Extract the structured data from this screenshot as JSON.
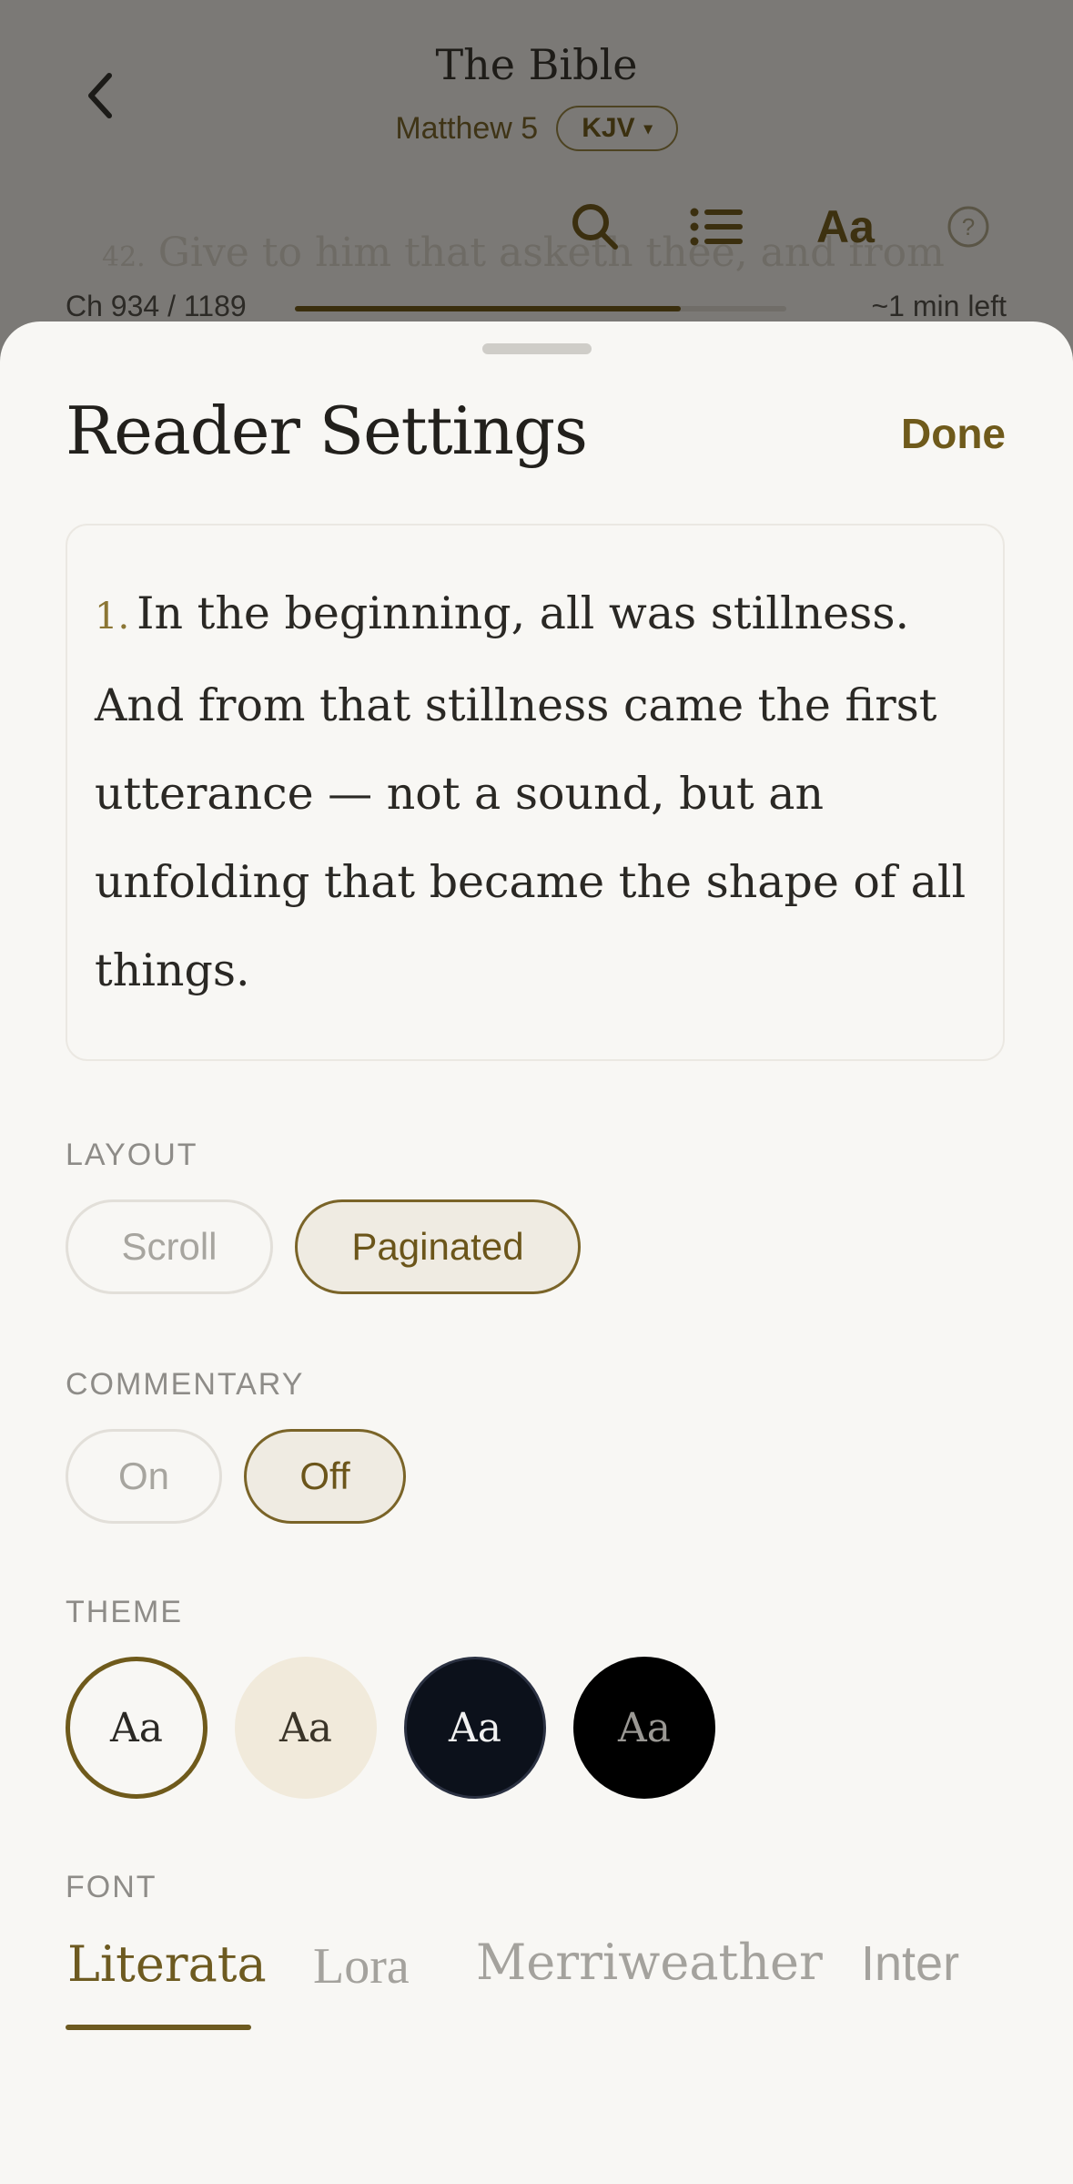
{
  "header": {
    "title": "The Bible",
    "chapter": "Matthew 5",
    "version": "KJV",
    "version_caret": "▾"
  },
  "toolbar": {
    "icons": [
      "search-icon",
      "list-icon",
      "text-size-icon",
      "help-icon"
    ],
    "text_size_label": "Aa",
    "help_label": "?"
  },
  "background_text": {
    "verse_number": "42.",
    "verse_text": "Give to him that asketh thee, and from"
  },
  "progress": {
    "chapter_label": "Ch 934 / 1189",
    "fraction": 0.7855,
    "time_left": "~1 min left"
  },
  "settings": {
    "title": "Reader Settings",
    "done_label": "Done",
    "preview": {
      "verse_number": "1.",
      "text": "In the beginning, all was stillness. And from that stillness came the first utterance — not a sound, but an unfolding that became the shape of all things."
    },
    "layout": {
      "label": "LAYOUT",
      "options": [
        "Scroll",
        "Paginated"
      ],
      "selected": "Paginated"
    },
    "commentary": {
      "label": "COMMENTARY",
      "options": [
        "On",
        "Off"
      ],
      "selected": "Off"
    },
    "theme": {
      "label": "THEME",
      "swatch_label": "Aa",
      "options": [
        {
          "name": "light",
          "bg": "#f8f7f4",
          "fg": "#2a2824"
        },
        {
          "name": "sepia",
          "bg": "#f1eadb",
          "fg": "#3a3428"
        },
        {
          "name": "navy",
          "bg": "#0c111b",
          "fg": "#f1f1f1"
        },
        {
          "name": "black",
          "bg": "#000000",
          "fg": "#9a9894"
        }
      ],
      "selected": "light"
    },
    "font": {
      "label": "FONT",
      "options": [
        "Literata",
        "Lora",
        "Merriweather",
        "Inter"
      ],
      "selected": "Literata"
    }
  },
  "colors": {
    "accent": "#6f5a1b",
    "overlay": "#7b7976",
    "sheet_bg": "#f8f7f4"
  }
}
